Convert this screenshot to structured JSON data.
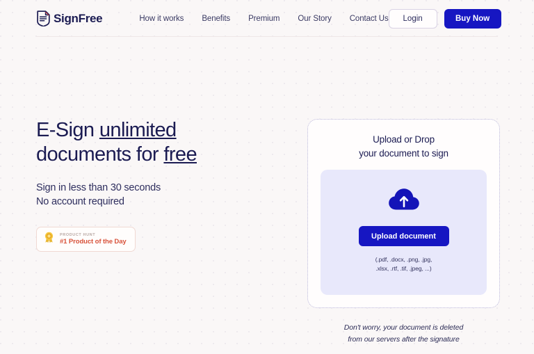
{
  "brand": {
    "name": "SignFree",
    "logo_icon": "document-shield-icon"
  },
  "nav": {
    "items": [
      {
        "label": "How it works"
      },
      {
        "label": "Benefits"
      },
      {
        "label": "Premium"
      },
      {
        "label": "Our Story"
      },
      {
        "label": "Contact Us"
      }
    ]
  },
  "header_actions": {
    "login_label": "Login",
    "buy_now_label": "Buy Now"
  },
  "hero": {
    "headline": {
      "part1": "E-Sign ",
      "underline1": "unlimited",
      "part2": "documents for ",
      "underline2": "free"
    },
    "subhead_line1": "Sign in less than 30 seconds",
    "subhead_line2": "No account required",
    "badge": {
      "icon": "medal-icon",
      "kicker": "PRODUCT HUNT",
      "title": "#1 Product of the Day"
    }
  },
  "upload": {
    "title_line1": "Upload or Drop",
    "title_line2": "your document to sign",
    "cloud_icon": "cloud-upload-icon",
    "button_label": "Upload document",
    "formats_line1": "(.pdf, .docx, .png, .jpg,",
    "formats_line2": ".xlsx, .rtf, .tif, .jpeg, ...)",
    "disclaimer_line1": "Don't worry, your document is deleted",
    "disclaimer_line2": "from our servers after the signature"
  },
  "colors": {
    "page_background": "#faf7f7",
    "brand_navy": "#1b1b52",
    "accent_blue": "#1616c2",
    "inner_lavender": "#e8e8fb",
    "badge_red": "#d8523a",
    "dotted_border": "#b8b4d8"
  }
}
